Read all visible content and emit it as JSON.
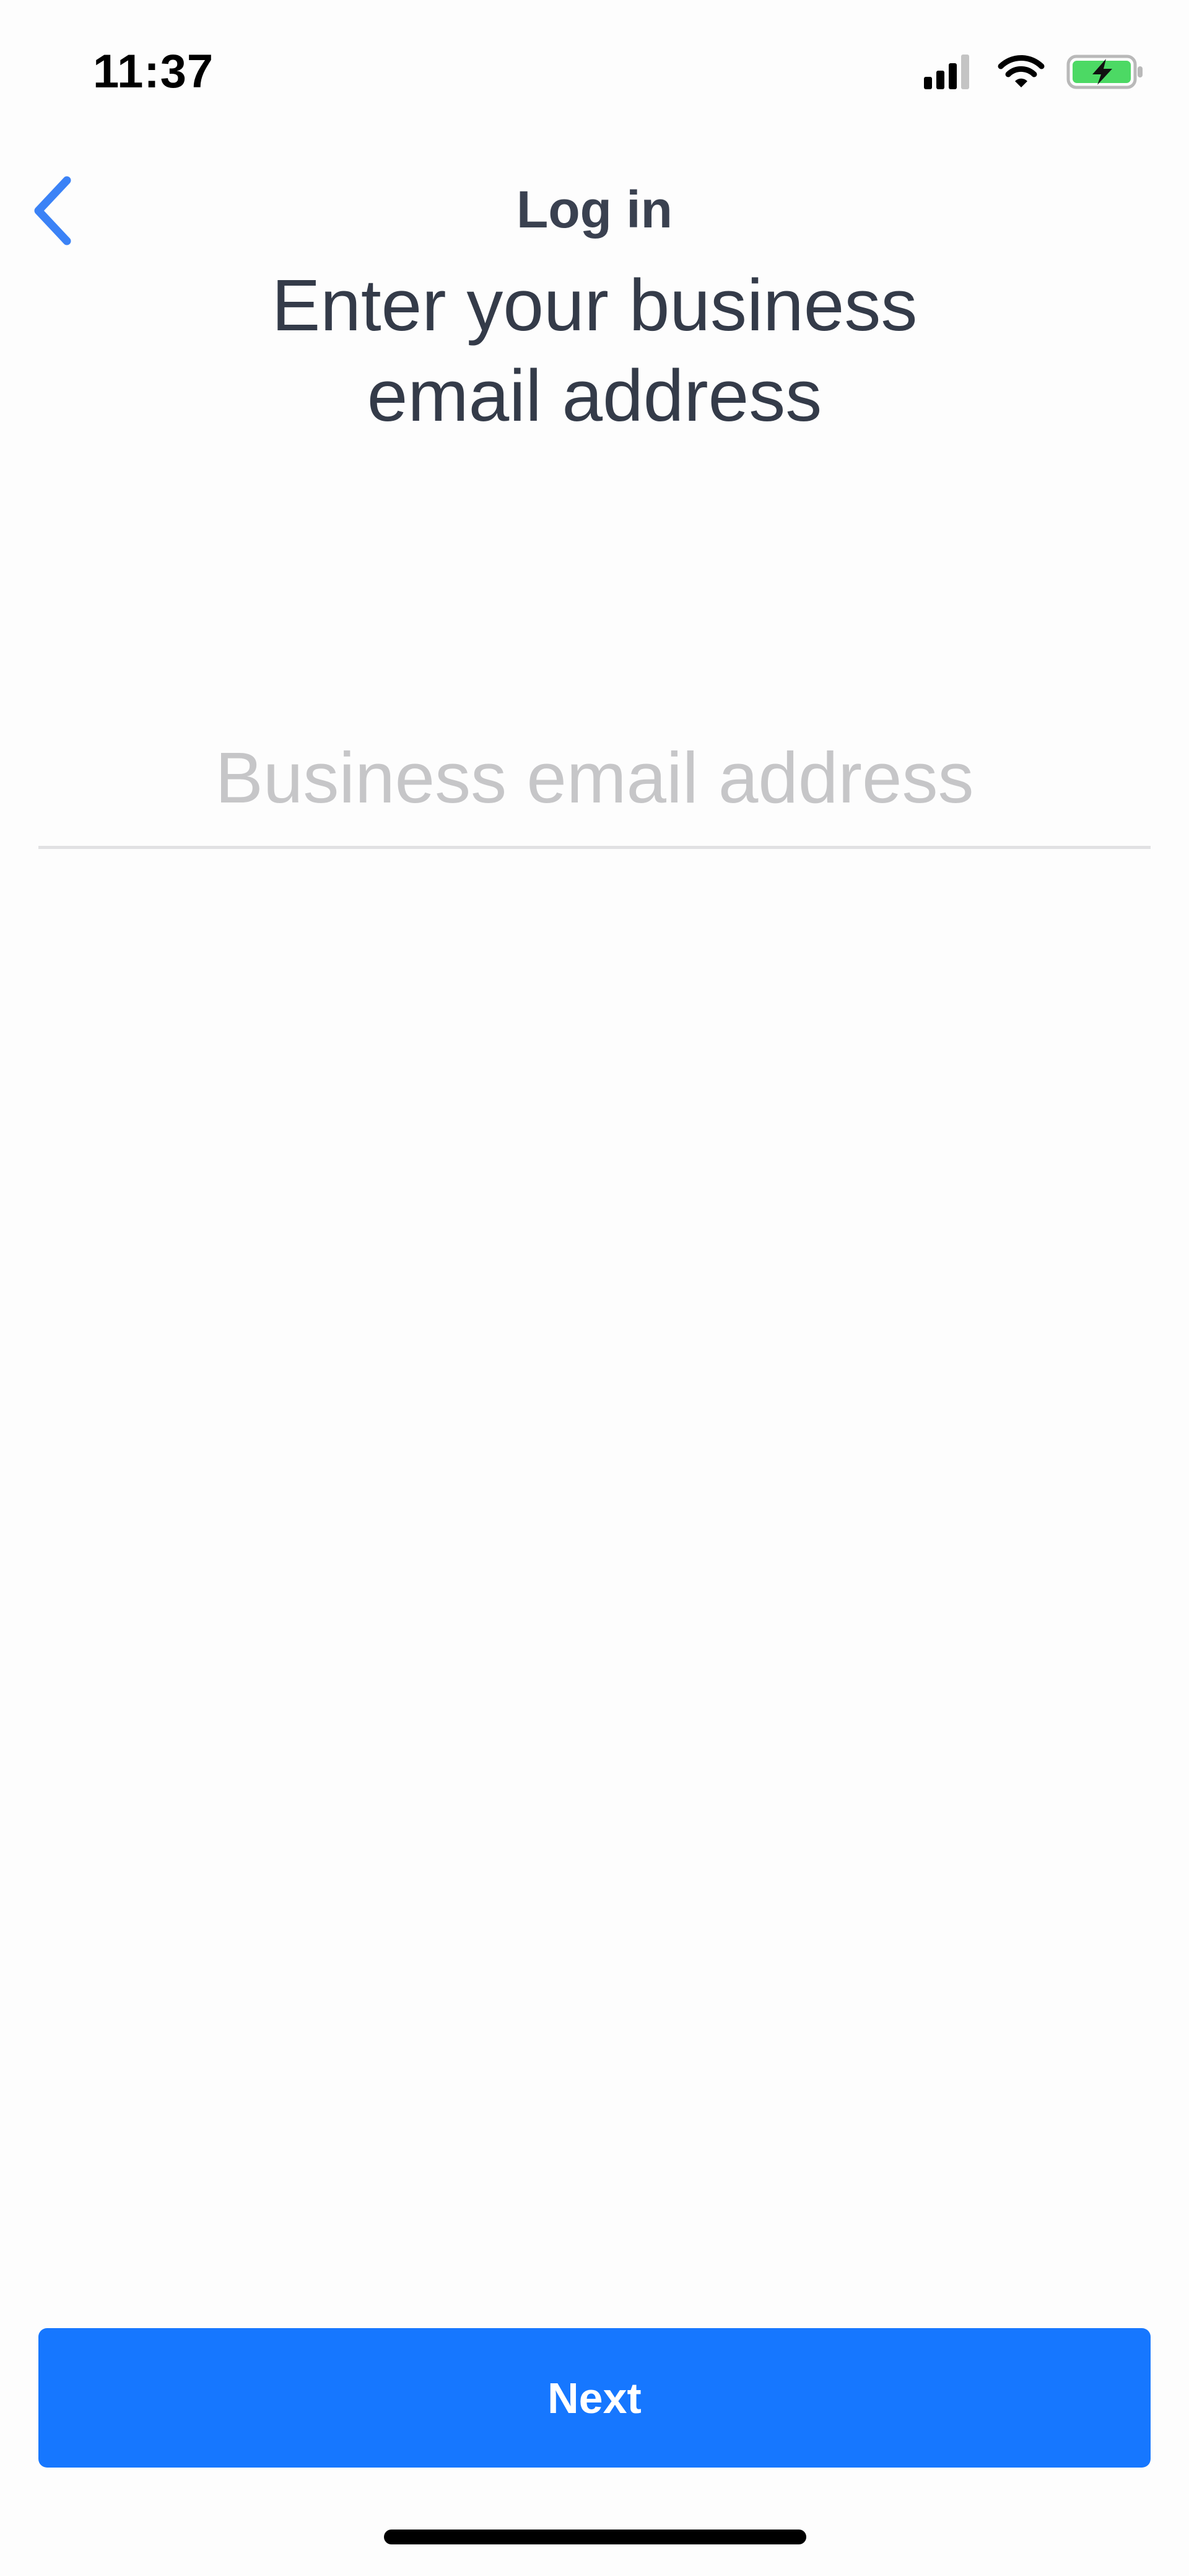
{
  "status_bar": {
    "time": "11:37",
    "signal_bars_active": 3,
    "signal_bars_total": 4,
    "battery_charging": true,
    "battery_color": "#4cd964"
  },
  "nav": {
    "title": "Log in",
    "back_icon": "chevron-left-icon",
    "back_color": "#3b82f6"
  },
  "heading": {
    "line1": "Enter your business",
    "line2": "email address"
  },
  "email": {
    "placeholder": "Business email address",
    "value": ""
  },
  "actions": {
    "next_label": "Next",
    "accent_color": "#1677ff"
  }
}
